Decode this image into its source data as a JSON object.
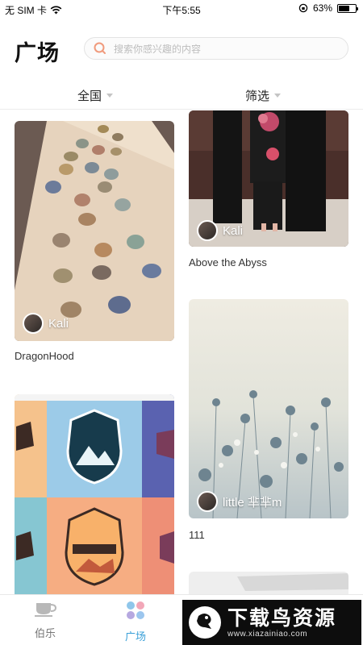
{
  "status_bar": {
    "carrier": "无 SIM 卡",
    "time": "下午5:55",
    "battery": "63%",
    "battery_level": 0.63
  },
  "header": {
    "title": "广场",
    "search_placeholder": "搜索你感兴趣的内容"
  },
  "filters": {
    "region": "全国",
    "screen": "筛选"
  },
  "cards": [
    {
      "author": "Kali",
      "caption": "DragonHood"
    },
    {
      "author": "Kali",
      "caption": "Above the Abyss"
    },
    {
      "author": "little 芈芈m",
      "caption": "111"
    },
    {
      "author": "",
      "caption": ""
    }
  ],
  "tabs": [
    {
      "label": "伯乐",
      "icon": "cup-icon"
    },
    {
      "label": "广场",
      "icon": "grid-dots-icon"
    }
  ],
  "watermark": {
    "text": "下载鸟资源",
    "url": "www.xiazainiao.com",
    "logo": "bird-logo"
  },
  "colors": {
    "accent": "#3aa0d8",
    "tab_inactive": "#777777"
  }
}
